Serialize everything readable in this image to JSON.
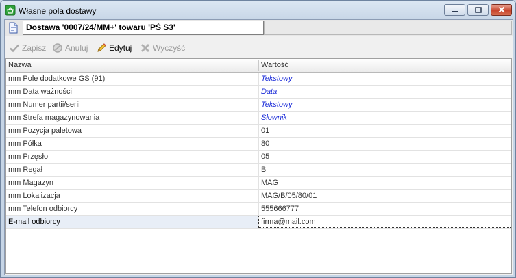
{
  "window": {
    "title": "Własne pola dostawy"
  },
  "document": {
    "title": "Dostawa '0007/24/MM+' towaru 'PŚ S3'"
  },
  "toolbar": {
    "save_label": "Zapisz",
    "cancel_label": "Anuluj",
    "edit_label": "Edytuj",
    "clear_label": "Wyczyść"
  },
  "grid": {
    "columns": {
      "name": "Nazwa",
      "value": "Wartość"
    },
    "rows": [
      {
        "name": "mm Pole dodatkowe GS (91)",
        "value": "Tekstowy",
        "typed": true
      },
      {
        "name": "mm Data ważności",
        "value": "Data",
        "typed": true
      },
      {
        "name": "mm Numer partii/serii",
        "value": "Tekstowy",
        "typed": true
      },
      {
        "name": "mm Strefa magazynowania",
        "value": "Słownik",
        "typed": true
      },
      {
        "name": "mm Pozycja paletowa",
        "value": "01",
        "typed": false
      },
      {
        "name": "mm Półka",
        "value": "80",
        "typed": false
      },
      {
        "name": "mm Przęsło",
        "value": "05",
        "typed": false
      },
      {
        "name": "mm Regał",
        "value": "B",
        "typed": false
      },
      {
        "name": "mm Magazyn",
        "value": "MAG",
        "typed": false
      },
      {
        "name": "mm Lokalizacja",
        "value": "MAG/B/05/80/01",
        "typed": false
      },
      {
        "name": "mm Telefon odbiorcy",
        "value": "555666777",
        "typed": false
      },
      {
        "name": "E-mail odbiorcy",
        "value": "firma@mail.com",
        "typed": false,
        "selected": true
      }
    ]
  },
  "colors": {
    "typed_value": "#1a2bd8",
    "window_frame": "#c6d5e6"
  },
  "icons": {
    "app": "green-basket-icon",
    "document": "document-icon",
    "save": "checkmark-icon",
    "cancel": "cancel-circle-icon",
    "edit": "pencil-icon",
    "clear": "x-icon"
  }
}
